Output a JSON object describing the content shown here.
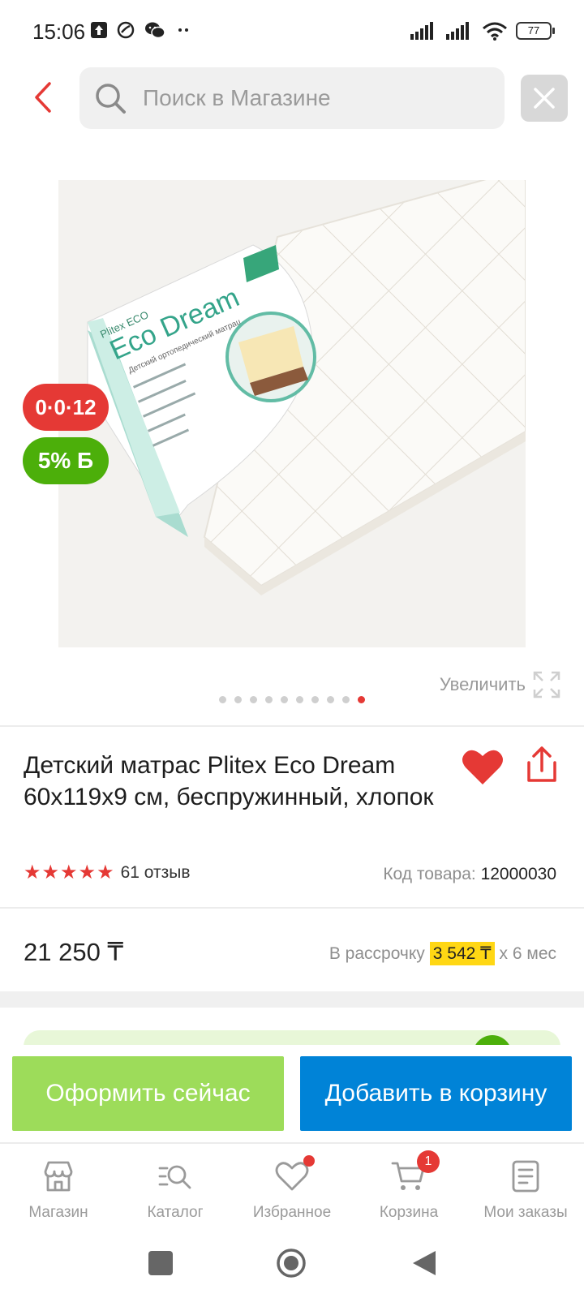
{
  "status_bar": {
    "time": "15:06",
    "battery": "77"
  },
  "search": {
    "placeholder": "Поиск в Магазине"
  },
  "product": {
    "image_labels": {
      "brand": "Plitex",
      "line": "ECO",
      "name": "Eco Dream",
      "subtitle": "Детский ортопедический матрац"
    },
    "badges": {
      "installment": "0·0·12",
      "bonus": "5% Б"
    },
    "zoom_label": "Увеличить",
    "gallery": {
      "count": 10,
      "active_index": 9
    },
    "title": "Детский матрас Plitex Eco Dream 60x119x9 см, беспружинный, хлопок",
    "rating": 5,
    "reviews_label": "61 отзыв",
    "sku_label": "Код товара:",
    "sku_value": "12000030",
    "price": "21 250 ₸",
    "installment_prefix": "В рассрочку",
    "installment_amount": "3 542 ₸",
    "installment_suffix": "x 6 мес"
  },
  "actions": {
    "buy_now": "Оформить сейчас",
    "add_to_cart": "Добавить в корзину"
  },
  "bottom_nav": [
    {
      "label": "Магазин",
      "icon": "store-icon"
    },
    {
      "label": "Каталог",
      "icon": "catalog-search-icon"
    },
    {
      "label": "Избранное",
      "icon": "heart-outline-icon",
      "has_dot": true
    },
    {
      "label": "Корзина",
      "icon": "cart-icon",
      "badge": "1"
    },
    {
      "label": "Мои заказы",
      "icon": "orders-icon"
    }
  ],
  "colors": {
    "accent_red": "#e53935",
    "bonus_green": "#4caf0a",
    "buy_now_green": "#9ddc5a",
    "cart_blue": "#0083d7",
    "installment_yellow": "#ffd714"
  }
}
